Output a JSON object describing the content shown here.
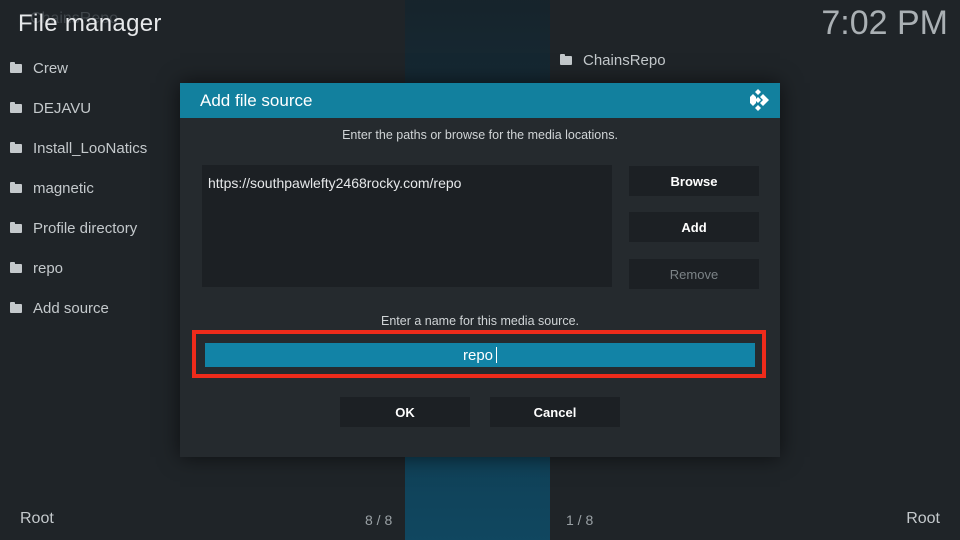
{
  "app": {
    "title": "File manager",
    "ghost_title": "ChainsRepo",
    "clock": "7:02 PM"
  },
  "left_panel": {
    "items": [
      "Crew",
      "DEJAVU",
      "Install_LooNatics",
      "magnetic",
      "Profile directory",
      "repo",
      "Add source"
    ],
    "footer_label": "Root",
    "footer_count": "8 / 8"
  },
  "right_panel": {
    "items": [
      "ChainsRepo"
    ],
    "footer_label": "Root",
    "footer_count": "1 / 8"
  },
  "dialog": {
    "title": "Add file source",
    "paths_hint": "Enter the paths or browse for the media locations.",
    "paths": [
      "https://southpawlefty2468rocky.com/repo"
    ],
    "browse_label": "Browse",
    "add_label": "Add",
    "remove_label": "Remove",
    "name_hint": "Enter a name for this media source.",
    "name_value": "repo",
    "ok_label": "OK",
    "cancel_label": "Cancel"
  },
  "colors": {
    "accent": "#12809e",
    "input_focus": "#1283a6",
    "highlight": "#ee2b1b"
  }
}
